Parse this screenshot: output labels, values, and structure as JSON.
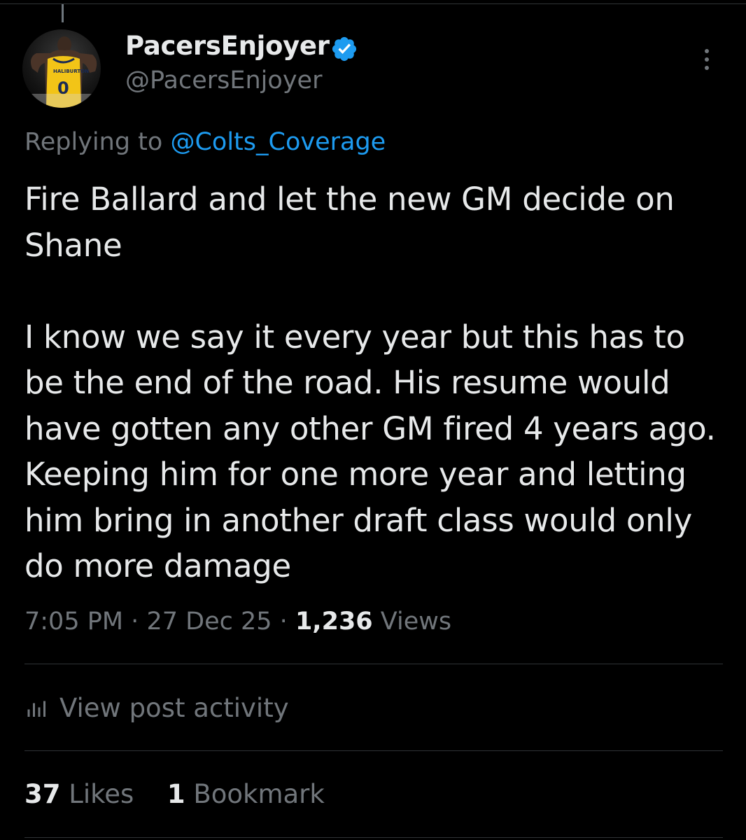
{
  "post": {
    "display_name": "PacersEnjoyer",
    "handle": "@PacersEnjoyer",
    "verified": true,
    "replying_prefix": "Replying to",
    "replying_to": "@Colts_Coverage",
    "text": "Fire Ballard and let the new GM decide on Shane\n\nI know we say it every year but this has to be the end of the road. His resume would have gotten any other GM fired 4 years ago. Keeping him for one more year and letting him bring in another draft class would only do more damage",
    "time": "7:05 PM",
    "separator": "·",
    "date": "27 Dec 25",
    "views_count": "1,236",
    "views_label": "Views",
    "activity_label": "View post activity",
    "likes_count": "37",
    "likes_label": "Likes",
    "bookmarks_count": "1",
    "bookmarks_label": "Bookmark"
  },
  "icons": {
    "verified": "verified-badge-icon",
    "more": "more-options-icon",
    "analytics": "analytics-icon"
  },
  "colors": {
    "background": "#000000",
    "text": "#e7e9ea",
    "secondary": "#71767b",
    "link": "#1d9bf0",
    "divider": "#2f3336"
  }
}
